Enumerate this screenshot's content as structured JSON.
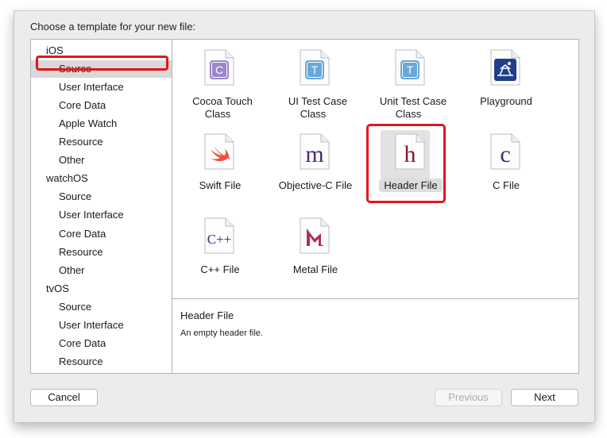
{
  "prompt": "Choose a template for your new file:",
  "sidebar": {
    "items": [
      {
        "label": "iOS",
        "kind": "platform"
      },
      {
        "label": "Source",
        "kind": "cat",
        "selected": true
      },
      {
        "label": "User Interface",
        "kind": "cat"
      },
      {
        "label": "Core Data",
        "kind": "cat"
      },
      {
        "label": "Apple Watch",
        "kind": "cat"
      },
      {
        "label": "Resource",
        "kind": "cat"
      },
      {
        "label": "Other",
        "kind": "cat"
      },
      {
        "label": "watchOS",
        "kind": "platform"
      },
      {
        "label": "Source",
        "kind": "cat"
      },
      {
        "label": "User Interface",
        "kind": "cat"
      },
      {
        "label": "Core Data",
        "kind": "cat"
      },
      {
        "label": "Resource",
        "kind": "cat"
      },
      {
        "label": "Other",
        "kind": "cat"
      },
      {
        "label": "tvOS",
        "kind": "platform"
      },
      {
        "label": "Source",
        "kind": "cat"
      },
      {
        "label": "User Interface",
        "kind": "cat"
      },
      {
        "label": "Core Data",
        "kind": "cat"
      },
      {
        "label": "Resource",
        "kind": "cat"
      }
    ]
  },
  "templates": [
    {
      "label": "Cocoa Touch Class",
      "icon": "cocoa-touch-class-icon",
      "glyph": "C",
      "style": "badge",
      "badge_color": "#9b88c9"
    },
    {
      "label": "UI Test Case Class",
      "icon": "ui-test-case-icon",
      "glyph": "T",
      "style": "badge",
      "badge_color": "#6aa7d8"
    },
    {
      "label": "Unit Test Case Class",
      "icon": "unit-test-case-icon",
      "glyph": "T",
      "style": "badge",
      "badge_color": "#6aa7d8"
    },
    {
      "label": "Playground",
      "icon": "playground-icon",
      "glyph": "",
      "style": "playground",
      "badge_color": "#1f3f8a"
    },
    {
      "label": "Swift File",
      "icon": "swift-icon",
      "glyph": "",
      "style": "swift",
      "badge_color": "#f0523a"
    },
    {
      "label": "Objective-C File",
      "icon": "objective-c-file-icon",
      "glyph": "m",
      "style": "letter",
      "badge_color": "#4a2a7a"
    },
    {
      "label": "Header File",
      "icon": "header-file-icon",
      "glyph": "h",
      "style": "letter",
      "badge_color": "#8a1a2a",
      "selected": true
    },
    {
      "label": "C File",
      "icon": "c-file-icon",
      "glyph": "c",
      "style": "letter",
      "badge_color": "#4a2a7a"
    },
    {
      "label": "C++ File",
      "icon": "cpp-file-icon",
      "glyph": "C++",
      "style": "cpp",
      "badge_color": "#3a2a7a"
    },
    {
      "label": "Metal File",
      "icon": "metal-file-icon",
      "glyph": "",
      "style": "metal",
      "badge_color": "#b0305a"
    }
  ],
  "description": {
    "title": "Header File",
    "text": "An empty header file."
  },
  "buttons": {
    "cancel": "Cancel",
    "previous": "Previous",
    "next": "Next"
  }
}
